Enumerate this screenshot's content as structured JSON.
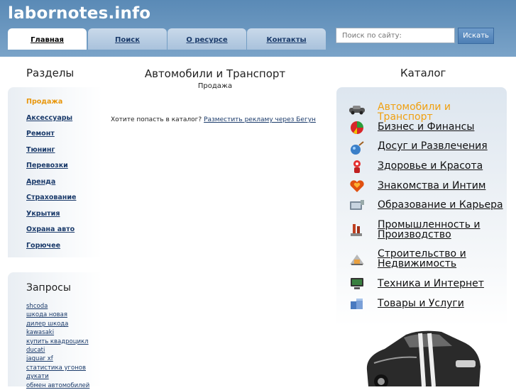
{
  "site": {
    "logo": "labornotes.info"
  },
  "nav": {
    "tabs": [
      {
        "label": "Главная"
      },
      {
        "label": "Поиск"
      },
      {
        "label": "О ресурсе"
      },
      {
        "label": "Контакты"
      }
    ]
  },
  "search": {
    "placeholder": "Поиск по сайту:",
    "button": "Искать"
  },
  "sections": {
    "title": "Разделы",
    "items": [
      "Продажа",
      "Аксессуары",
      "Ремонт",
      "Тюнинг",
      "Перевозки",
      "Аренда",
      "Страхование",
      "Укрытия",
      "Охрана авто",
      "Горючее"
    ]
  },
  "queries": {
    "title": "Запросы",
    "items": [
      "shcoda",
      "шкода новая",
      "дилер шкода",
      "kawasaki",
      "купить квадроцикл",
      "ducati",
      "jaguar xf",
      "статистика угонов",
      "дукати",
      "обмен автомобилей"
    ]
  },
  "main": {
    "title": "Автомобили и Транспорт",
    "subtitle": "Продажа",
    "ad_text": "Хотите попасть в каталог?",
    "ad_link": "Разместить рекламу через Бегун"
  },
  "catalog": {
    "title": "Каталог",
    "items": [
      {
        "label": "Автомобили и Транспорт",
        "icon": "car-icon"
      },
      {
        "label": "Бизнес и Финансы",
        "icon": "chart-icon"
      },
      {
        "label": "Досуг и Развлечения",
        "icon": "leisure-icon"
      },
      {
        "label": "Здоровье и Красота",
        "icon": "health-icon"
      },
      {
        "label": "Знакомства и Интим",
        "icon": "hearts-icon"
      },
      {
        "label": "Образование и Карьера",
        "icon": "education-icon"
      },
      {
        "label": "Промышленность и",
        "label2": "Производство",
        "icon": "industry-icon"
      },
      {
        "label": "Строительство и",
        "label2": "Недвижимость",
        "icon": "construction-icon"
      },
      {
        "label": "Техника и Интернет",
        "icon": "computer-icon"
      },
      {
        "label": "Товары и Услуги",
        "icon": "goods-icon"
      }
    ]
  },
  "colors": {
    "header": "#6a95bf",
    "active": "#f0a010",
    "link": "#1a3a6a"
  }
}
